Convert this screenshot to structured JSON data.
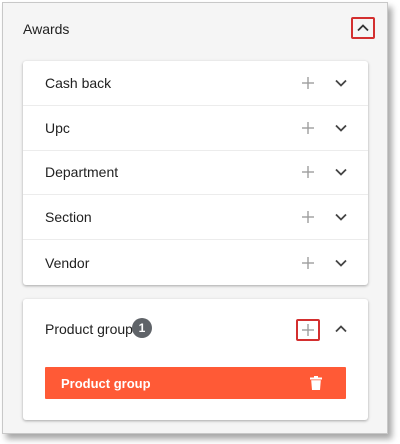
{
  "panel": {
    "title": "Awards",
    "collapse_icon": "chevron-up-icon"
  },
  "award_types": [
    {
      "label": "Cash back",
      "add_icon": "plus-icon",
      "expand_icon": "chevron-down-icon"
    },
    {
      "label": "Upc",
      "add_icon": "plus-icon",
      "expand_icon": "chevron-down-icon"
    },
    {
      "label": "Department",
      "add_icon": "plus-icon",
      "expand_icon": "chevron-down-icon"
    },
    {
      "label": "Section",
      "add_icon": "plus-icon",
      "expand_icon": "chevron-down-icon"
    },
    {
      "label": "Vendor",
      "add_icon": "plus-icon",
      "expand_icon": "chevron-down-icon"
    }
  ],
  "product_group": {
    "label": "Product group",
    "count": "1",
    "add_icon": "plus-icon",
    "collapse_icon": "chevron-up-icon",
    "items": [
      {
        "label": "Product group",
        "delete_icon": "trash-icon"
      }
    ]
  },
  "colors": {
    "highlight": "#d32f2f",
    "item_bar": "#ff5a36",
    "badge": "#5f6368"
  }
}
